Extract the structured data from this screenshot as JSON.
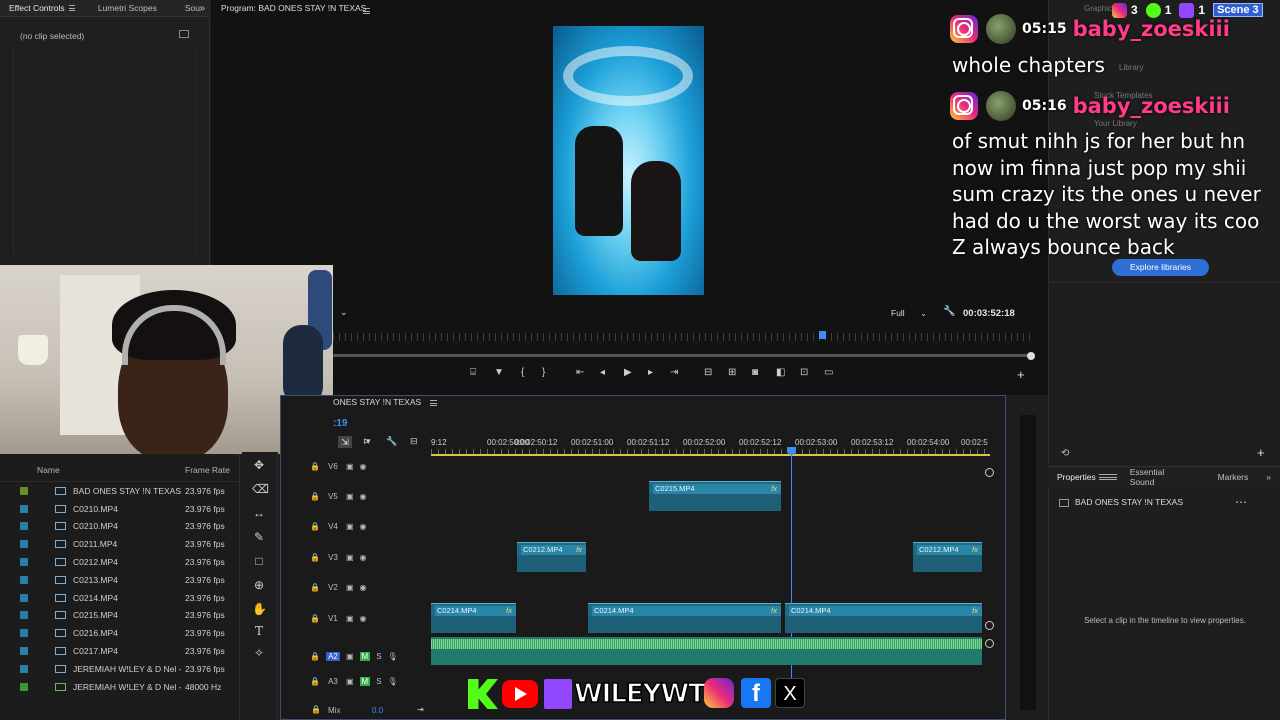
{
  "effect_controls": {
    "tabs": [
      "Effect Controls",
      "Lumetri Scopes",
      "Sou"
    ],
    "no_clip": "(no clip selected)"
  },
  "program": {
    "title": "Program: BAD ONES STAY !N TEXAS",
    "zoom": "Full",
    "timecode": "00:03:52:18"
  },
  "chat": [
    {
      "time": "05:15",
      "user": "baby_zoeskiii",
      "message": "whole chapters"
    },
    {
      "time": "05:16",
      "user": "baby_zoeskiii",
      "message": "of smut nihh js for her but hn\nnow im finna just pop my shii\nsum crazy its the ones u never\nhad do u the worst way its coo\nZ always bounce back"
    }
  ],
  "stream_badges": {
    "ig_count": "3",
    "kick_count": "1",
    "twitch_count": "1",
    "scene": "Scene 3"
  },
  "libraries": {
    "explore_button": "Explore libraries",
    "faint": [
      "Graphics",
      "Library",
      "Stock Templates",
      "Your Library"
    ]
  },
  "properties": {
    "tabs": [
      "Properties",
      "Essential Sound",
      "Markers"
    ],
    "sequence": "BAD ONES STAY !N TEXAS",
    "empty_hint": "Select a clip in the timeline to view properties."
  },
  "project": {
    "headers": {
      "name": "Name",
      "frame_rate": "Frame Rate"
    },
    "items": [
      {
        "name": "BAD ONES STAY !N TEXAS",
        "rate": "23.976 fps",
        "color": "#6b8e23"
      },
      {
        "name": "C0210.MP4",
        "rate": "23.976 fps",
        "color": "#2a7fa8"
      },
      {
        "name": "C0210.MP4",
        "rate": "23.976 fps",
        "color": "#2a7fa8"
      },
      {
        "name": "C0211.MP4",
        "rate": "23.976 fps",
        "color": "#2a7fa8"
      },
      {
        "name": "C0212.MP4",
        "rate": "23.976 fps",
        "color": "#2a7fa8"
      },
      {
        "name": "C0213.MP4",
        "rate": "23.976 fps",
        "color": "#2a7fa8"
      },
      {
        "name": "C0214.MP4",
        "rate": "23.976 fps",
        "color": "#2a7fa8"
      },
      {
        "name": "C0215.MP4",
        "rate": "23.976 fps",
        "color": "#2a7fa8"
      },
      {
        "name": "C0216.MP4",
        "rate": "23.976 fps",
        "color": "#2a7fa8"
      },
      {
        "name": "C0217.MP4",
        "rate": "23.976 fps",
        "color": "#2a7fa8"
      },
      {
        "name": "JEREMIAH W!LEY & D Nel -",
        "rate": "23.976 fps",
        "color": "#2a7fa8"
      },
      {
        "name": "JEREMIAH W!LEY & D Nel -",
        "rate": "48000 Hz",
        "color": "#3c9a3c"
      }
    ]
  },
  "timeline": {
    "sequence_tab": "ONES STAY !N TEXAS",
    "timecode_fragment": ":19",
    "ruler": [
      "9:12",
      "00:02:50:00",
      "00:02:50:12",
      "00:02:51:00",
      "00:02:51:12",
      "00:02:52:00",
      "00:02:52:12",
      "00:02:53:00",
      "00:02:53:12",
      "00:02:54:00",
      "00:02:5"
    ],
    "video_tracks": [
      "V6",
      "V5",
      "V4",
      "V3",
      "V2",
      "V1"
    ],
    "audio_tracks": [
      "A2",
      "A3"
    ],
    "mix_label": "Mix",
    "mix_value": "0.0",
    "clips": [
      {
        "label": "C0215.MP4",
        "fx": "fx"
      },
      {
        "label": "C0212.MP4",
        "fx": "fx"
      },
      {
        "label": "C0212.MP4",
        "fx": "fx"
      },
      {
        "label": "C0214.MP4",
        "fx": "fx"
      },
      {
        "label": "C0214.MP4",
        "fx": "fx"
      },
      {
        "label": "C0214.MP4",
        "fx": "fx"
      }
    ]
  },
  "banner": {
    "handle": "WILEYWTF"
  },
  "colors": {
    "accent": "#2d8ceb",
    "clip": "#1f6a86",
    "audio": "#227a6c",
    "username": "#ff3b8a"
  }
}
